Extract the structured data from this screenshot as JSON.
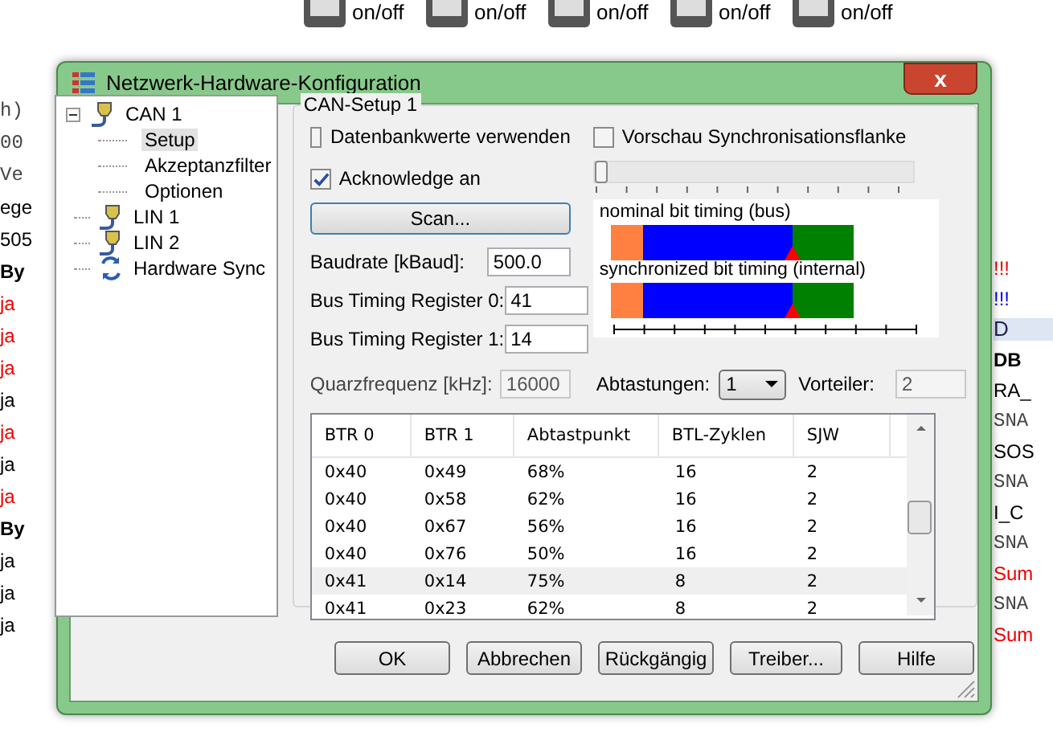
{
  "background": {
    "switch_labels": [
      "on/off",
      "on/off",
      "on/off",
      "on/off",
      "on/off"
    ],
    "left_fragments": [
      {
        "text": "h)",
        "kind": "code"
      },
      {
        "text": "00",
        "kind": "code"
      },
      {
        "text": "Ve",
        "kind": "code"
      },
      {
        "text": "ege",
        "kind": "plain"
      },
      {
        "text": "505",
        "kind": "plain"
      },
      {
        "text": "By",
        "kind": "bold"
      },
      {
        "text": "ja",
        "kind": "alert"
      },
      {
        "text": "ja",
        "kind": "alert"
      },
      {
        "text": "ja",
        "kind": "alert"
      },
      {
        "text": "ja",
        "kind": "plain"
      },
      {
        "text": "ja",
        "kind": "alert"
      },
      {
        "text": "ja",
        "kind": "plain"
      },
      {
        "text": "ja",
        "kind": "alert"
      },
      {
        "text": "By",
        "kind": "bold"
      },
      {
        "text": "ja",
        "kind": "plain"
      },
      {
        "text": "ja",
        "kind": "plain"
      },
      {
        "text": "ja",
        "kind": "plain"
      }
    ],
    "right_fragments": [
      {
        "text": "!!!",
        "kind": "alert"
      },
      {
        "text": "!!!",
        "kind": "info"
      },
      {
        "text": "D",
        "kind": "title"
      },
      {
        "text": "DB",
        "kind": "bold"
      },
      {
        "text": "RA_",
        "kind": "plain"
      },
      {
        "text": "SNA",
        "kind": "code"
      },
      {
        "text": "SOS",
        "kind": "plain"
      },
      {
        "text": "SNA",
        "kind": "code"
      },
      {
        "text": "I_C",
        "kind": "plain"
      },
      {
        "text": "SNA",
        "kind": "code"
      },
      {
        "text": "Sum",
        "kind": "alert"
      },
      {
        "text": "SNA",
        "kind": "code"
      },
      {
        "text": "Sum",
        "kind": "alert"
      }
    ]
  },
  "window": {
    "title": "Netzwerk-Hardware-Konfiguration",
    "close": "x"
  },
  "tree": [
    {
      "label": "CAN 1",
      "kind": "connector",
      "expanded": true,
      "selected": false,
      "children": [
        {
          "label": "Setup",
          "selected": true
        },
        {
          "label": "Akzeptanzfilter",
          "selected": false
        },
        {
          "label": "Optionen",
          "selected": false
        }
      ]
    },
    {
      "label": "LIN 1",
      "kind": "connector",
      "selected": false
    },
    {
      "label": "LIN 2",
      "kind": "connector",
      "selected": false
    },
    {
      "label": "Hardware Sync",
      "kind": "sync",
      "selected": false
    }
  ],
  "group": {
    "title": "CAN-Setup 1",
    "checkboxes": [
      {
        "label": "Datenbankwerte verwenden",
        "checked": false
      },
      {
        "label": "Vorschau Synchronisationsflanke",
        "checked": false
      },
      {
        "label": "Acknowledge an",
        "checked": true
      }
    ],
    "slider": {
      "level": 0.0
    },
    "scan_button": "Scan...",
    "fields": [
      {
        "label": "Baudrate [kBaud]:",
        "value": "500.0"
      },
      {
        "label": "Bus Timing Register 0:",
        "value": "41"
      },
      {
        "label": "Bus Timing Register 1:",
        "value": "14"
      }
    ],
    "timing": [
      {
        "title": "nominal bit timing (bus)"
      },
      {
        "title": "synchronized bit timing (internal)"
      }
    ],
    "quarz": {
      "label": "Quarzfrequenz [kHz]:",
      "value": "16000",
      "disabled": true
    },
    "abtastungen": {
      "label": "Abtastungen:",
      "value": "1"
    },
    "vorteiler": {
      "label": "Vorteiler:",
      "value": "2",
      "disabled": true
    },
    "table": {
      "columns": [
        "BTR 0",
        "BTR 1",
        "Abtastpunkt",
        "BTL-Zyklen",
        "SJW"
      ],
      "rows": [
        {
          "cells": [
            "0x40",
            "0x49",
            "68%",
            "16",
            "2"
          ],
          "selected": false
        },
        {
          "cells": [
            "0x40",
            "0x58",
            "62%",
            "16",
            "2"
          ],
          "selected": false
        },
        {
          "cells": [
            "0x40",
            "0x67",
            "56%",
            "16",
            "2"
          ],
          "selected": false
        },
        {
          "cells": [
            "0x40",
            "0x76",
            "50%",
            "16",
            "2"
          ],
          "selected": false
        },
        {
          "cells": [
            "0x41",
            "0x14",
            "75%",
            "8",
            "2"
          ],
          "selected": true
        },
        {
          "cells": [
            "0x41",
            "0x23",
            "62%",
            "8",
            "2"
          ],
          "selected": false
        }
      ]
    }
  },
  "buttons": [
    "OK",
    "Abbrechen",
    "Rückgängig",
    "Treiber...",
    "Hilfe"
  ]
}
